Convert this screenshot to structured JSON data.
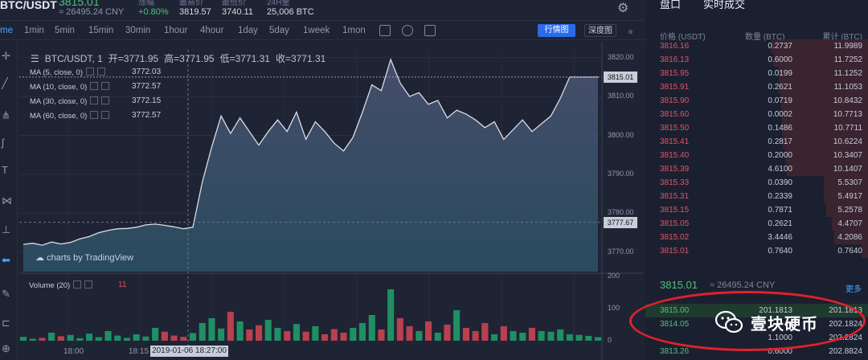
{
  "header": {
    "pair": "BTC/USDT",
    "last_price": "3815.01",
    "last_price_cny": "≈ 26495.24 CNY",
    "stats": [
      {
        "label": "涨幅",
        "value": "+0.80%"
      },
      {
        "label": "最高价",
        "value": "3819.57"
      },
      {
        "label": "最低价",
        "value": "3740.11"
      },
      {
        "label": "24H量",
        "value": "25,006 BTC"
      }
    ]
  },
  "toolbar": {
    "chart_type": "me",
    "timeframes": [
      "1min",
      "5min",
      "15min",
      "30min",
      "1hour",
      "4hour",
      "1day",
      "5day",
      "1week",
      "1mon"
    ],
    "active_view": "行情图",
    "depth_view": "深度图"
  },
  "chart": {
    "ohlc_title": "BTC/USDT, 1",
    "open": "开=3771.95",
    "high": "高=3771.95",
    "low": "低=3771.31",
    "close": "收=3771.31",
    "mas": [
      {
        "label": "MA (5, close, 0)",
        "value": "3772.03"
      },
      {
        "label": "MA (10, close, 0)",
        "value": "3772.57"
      },
      {
        "label": "MA (30, close, 0)",
        "value": "3772.15"
      },
      {
        "label": "MA (60, close, 0)",
        "value": "3772.57"
      }
    ],
    "tradingview": "charts by TradingView",
    "volume_label": "Volume (20)",
    "volume_value": "11",
    "price_ticks": [
      "3820.00",
      "3810.00",
      "3800.00",
      "3790.00",
      "3780.00",
      "3770.00"
    ],
    "volume_ticks": [
      "200",
      "100",
      "0"
    ],
    "current_price_tag": "3815.01",
    "cursor_price_tag": "3777.67",
    "time_ticks": [
      "18:00",
      "18:15"
    ],
    "time_cursor": "2019-01-06 18:27:00"
  },
  "chart_data": {
    "type": "area",
    "title": "BTC/USDT, 1",
    "xlabel": "",
    "ylabel": "",
    "ylim": [
      3765,
      3822
    ],
    "price": [
      3772.0,
      3772.3,
      3771.8,
      3772.6,
      3772.1,
      3772.5,
      3773.4,
      3774.0,
      3775.0,
      3775.6,
      3776.0,
      3776.1,
      3776.4,
      3777.0,
      3777.2,
      3776.9,
      3776.5,
      3776.0,
      3776.4,
      3788.0,
      3797.0,
      3805.0,
      3800.5,
      3804.5,
      3801.0,
      3797.5,
      3801.0,
      3804.0,
      3801.0,
      3806.0,
      3799.0,
      3803.5,
      3801.0,
      3798.0,
      3796.0,
      3799.5,
      3806.0,
      3813.0,
      3811.5,
      3819.5,
      3813.5,
      3810.0,
      3811.0,
      3808.0,
      3809.0,
      3804.5,
      3806.5,
      3805.5,
      3804.0,
      3802.0,
      3803.5,
      3799.0,
      3801.5,
      3804.0,
      3801.0,
      3803.0,
      3805.0,
      3809.5,
      3815.0,
      3815.0,
      3815.0,
      3815.0
    ],
    "volume": [
      12,
      6,
      9,
      25,
      14,
      18,
      8,
      22,
      11,
      30,
      16,
      9,
      20,
      13,
      40,
      28,
      16,
      12,
      24,
      55,
      70,
      38,
      90,
      60,
      35,
      48,
      65,
      40,
      30,
      52,
      28,
      45,
      20,
      36,
      25,
      40,
      55,
      80,
      35,
      160,
      70,
      45,
      30,
      60,
      25,
      50,
      95,
      40,
      30,
      55,
      20,
      45,
      30,
      25,
      40,
      30,
      28,
      35,
      20,
      18,
      15,
      11
    ],
    "volume_ylim": [
      0,
      200
    ]
  },
  "sidebar": {
    "tabs": [
      "盘口",
      "实时成交"
    ],
    "headers": [
      "价格 (USDT)",
      "数量 (BTC)",
      "累计 (BTC)"
    ],
    "asks": [
      {
        "price": "3816.16",
        "qty": "0.2737",
        "cum": "11.9989"
      },
      {
        "price": "3816.13",
        "qty": "0.6000",
        "cum": "11.7252"
      },
      {
        "price": "3815.95",
        "qty": "0.0199",
        "cum": "11.1252"
      },
      {
        "price": "3815.91",
        "qty": "0.2621",
        "cum": "11.1053"
      },
      {
        "price": "3815.90",
        "qty": "0.0719",
        "cum": "10.8432"
      },
      {
        "price": "3815.60",
        "qty": "0.0002",
        "cum": "10.7713"
      },
      {
        "price": "3815.50",
        "qty": "0.1486",
        "cum": "10.7711"
      },
      {
        "price": "3815.41",
        "qty": "0.2817",
        "cum": "10.6224"
      },
      {
        "price": "3815.40",
        "qty": "0.2000",
        "cum": "10.3407"
      },
      {
        "price": "3815.39",
        "qty": "4.6100",
        "cum": "10.1407"
      },
      {
        "price": "3815.33",
        "qty": "0.0390",
        "cum": "5.5307"
      },
      {
        "price": "3815.31",
        "qty": "0.2339",
        "cum": "5.4917"
      },
      {
        "price": "3815.15",
        "qty": "0.7871",
        "cum": "5.2578"
      },
      {
        "price": "3815.05",
        "qty": "0.2621",
        "cum": "4.4707"
      },
      {
        "price": "3815.02",
        "qty": "3.4446",
        "cum": "4.2086"
      },
      {
        "price": "3815.01",
        "qty": "0.7640",
        "cum": "0.7640"
      }
    ],
    "mid_price": "3815.01",
    "mid_cny": "≈ 26495.24 CNY",
    "more": "更多",
    "bids": [
      {
        "price": "3815.00",
        "qty": "201.1813",
        "cum": "201.1813"
      },
      {
        "price": "3814.05",
        "qty": "",
        "cum": "202.1824"
      },
      {
        "price": "",
        "qty": "1.1000",
        "cum": "202.2824"
      },
      {
        "price": "3813.26",
        "qty": "0.6000",
        "cum": "202.8824"
      }
    ]
  },
  "watermark": "壹块硬币"
}
